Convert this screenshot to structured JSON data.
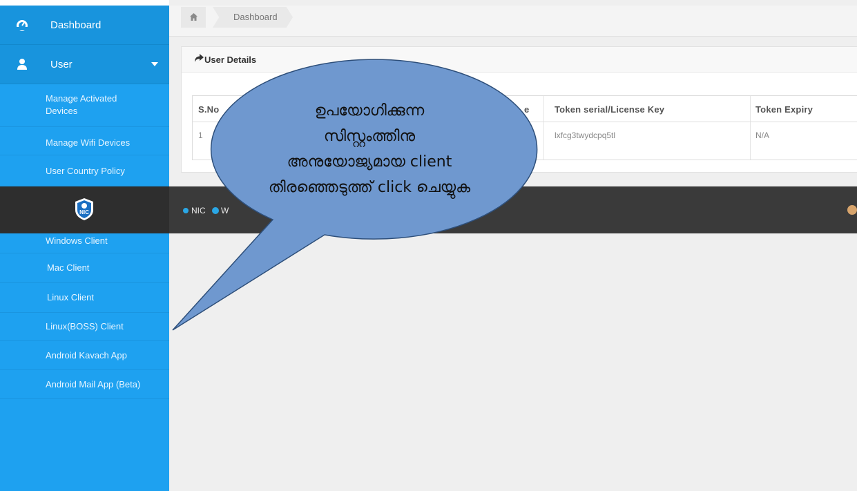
{
  "sidebar": {
    "items": [
      {
        "label": "Dashboard",
        "icon": "dashboard-icon"
      },
      {
        "label": "User",
        "icon": "user-icon"
      }
    ],
    "user_submenu": [
      {
        "label": "Manage Activated Devices"
      },
      {
        "label": "Manage Wifi Devices"
      },
      {
        "label": "User Country Policy"
      }
    ],
    "client_menu": [
      {
        "label": "Windows Client"
      },
      {
        "label": "Mac Client"
      },
      {
        "label": "Linux Client"
      },
      {
        "label": "Linux(BOSS) Client"
      },
      {
        "label": "Android Kavach App"
      },
      {
        "label": "Android Mail App (Beta)"
      }
    ]
  },
  "breadcrumb": {
    "home_icon": "home-icon",
    "current": "Dashboard"
  },
  "panel": {
    "title": "User Details",
    "icon": "share-arrow-icon",
    "columns": [
      "S.No",
      "e",
      "Token serial/License Key",
      "Token Expiry"
    ],
    "rows": [
      [
        "1",
        "",
        "lxfcg3twydcpq5tl",
        "N/A"
      ]
    ]
  },
  "footer": {
    "logo_text": "NIC",
    "nic_label": "NIC",
    "second_label": "W"
  },
  "callout": {
    "lines": [
      "ഉപയോഗിക്കുന്ന",
      "സിസ്റ്റംത്തിനു",
      "അനുയോജ്യമായ client",
      "തിരഞ്ഞെടുത്ത് click ചെയ്യുക"
    ]
  },
  "colors": {
    "sidebar": "#1ea1f0",
    "sidebar_item": "#1894dd",
    "dark_bar": "#3a3a3a",
    "callout_fill": "#6f98cf",
    "callout_stroke": "#2e4f7a"
  }
}
